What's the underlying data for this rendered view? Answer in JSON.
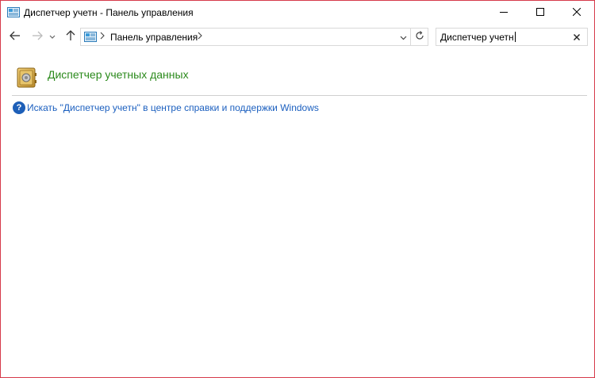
{
  "window": {
    "title": "Диспетчер учетн - Панель управления",
    "icon": "control-panel-icon",
    "buttons": {
      "minimize_icon": "minimize-icon",
      "maximize_icon": "maximize-icon",
      "close_icon": "close-icon"
    }
  },
  "nav": {
    "back_icon": "arrow-left-icon",
    "forward_icon": "arrow-right-icon",
    "recent_icon": "chevron-down-icon",
    "up_icon": "arrow-up-icon",
    "address": {
      "crumbs": [
        "Панель управления"
      ],
      "dropdown_icon": "chevron-down-icon",
      "refresh_icon": "refresh-icon"
    },
    "search": {
      "value": "Диспетчер учетн",
      "clear_icon": "close-icon"
    }
  },
  "content": {
    "result": {
      "title": "Диспетчер учетных данных",
      "icon": "credential-manager-icon"
    },
    "help": {
      "icon": "help-icon",
      "icon_glyph": "?",
      "link": "Искать \"Диспетчер учетн\" в центре справки и поддержки Windows"
    }
  },
  "colors": {
    "border": "#d63a4a",
    "result_title": "#2b8a1c",
    "link": "#1b5fbf",
    "help_icon_bg": "#1d5fb8"
  }
}
